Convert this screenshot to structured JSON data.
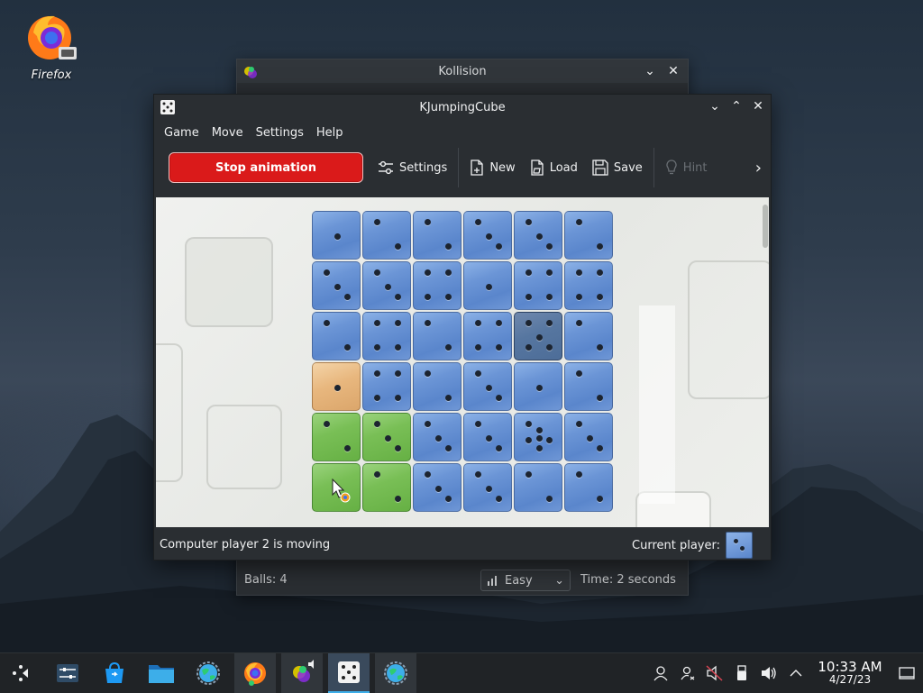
{
  "desktop": {
    "icon_label": "Firefox"
  },
  "kollision": {
    "title": "Kollision",
    "balls": "Balls: 4",
    "difficulty": "Easy",
    "time": "Time: 2 seconds"
  },
  "kjc": {
    "title": "KJumpingCube",
    "menu": [
      "Game",
      "Move",
      "Settings",
      "Help"
    ],
    "toolbar": {
      "stop": "Stop animation",
      "settings": "Settings",
      "new": "New",
      "load": "Load",
      "save": "Save",
      "hint": "Hint"
    },
    "status": "Computer player 2 is moving",
    "current_player_label": "Current player:",
    "board": {
      "rows": [
        [
          [
            "blue",
            1,
            ""
          ],
          [
            "blue",
            2,
            ""
          ],
          [
            "blue",
            2,
            ""
          ],
          [
            "blue",
            3,
            ""
          ],
          [
            "blue",
            3,
            ""
          ],
          [
            "blue",
            2,
            ""
          ]
        ],
        [
          [
            "blue",
            3,
            ""
          ],
          [
            "blue",
            3,
            ""
          ],
          [
            "blue",
            4,
            ""
          ],
          [
            "blue",
            1,
            ""
          ],
          [
            "blue",
            4,
            ""
          ],
          [
            "blue",
            4,
            ""
          ]
        ],
        [
          [
            "blue",
            2,
            ""
          ],
          [
            "blue",
            4,
            ""
          ],
          [
            "blue",
            2,
            ""
          ],
          [
            "blue",
            4,
            ""
          ],
          [
            "blue",
            5,
            "dark"
          ],
          [
            "blue",
            2,
            ""
          ]
        ],
        [
          [
            "tan",
            1,
            ""
          ],
          [
            "blue",
            4,
            ""
          ],
          [
            "blue",
            2,
            ""
          ],
          [
            "blue",
            3,
            ""
          ],
          [
            "blue",
            1,
            ""
          ],
          [
            "blue",
            2,
            ""
          ]
        ],
        [
          [
            "green",
            2,
            ""
          ],
          [
            "green",
            3,
            ""
          ],
          [
            "blue",
            3,
            ""
          ],
          [
            "blue",
            3,
            ""
          ],
          [
            "blue",
            6,
            ""
          ],
          [
            "blue",
            3,
            ""
          ]
        ],
        [
          [
            "green",
            1,
            ""
          ],
          [
            "green",
            2,
            ""
          ],
          [
            "blue",
            3,
            ""
          ],
          [
            "blue",
            3,
            ""
          ],
          [
            "blue",
            2,
            ""
          ],
          [
            "blue",
            2,
            ""
          ]
        ]
      ]
    },
    "colors": {
      "blue": "#6b95d6",
      "green": "#79bf56",
      "tan": "#e8b77e",
      "stop": "#da1a1a"
    }
  },
  "taskbar": {
    "time": "10:33 AM",
    "date": "4/27/23",
    "apps": [
      "application-launcher-icon",
      "system-settings-icon",
      "discover-store-icon",
      "dolphin-files-icon",
      "globe-icon",
      "firefox-icon",
      "kollision-icon",
      "kjumpingcube-icon",
      "globe-icon"
    ]
  }
}
